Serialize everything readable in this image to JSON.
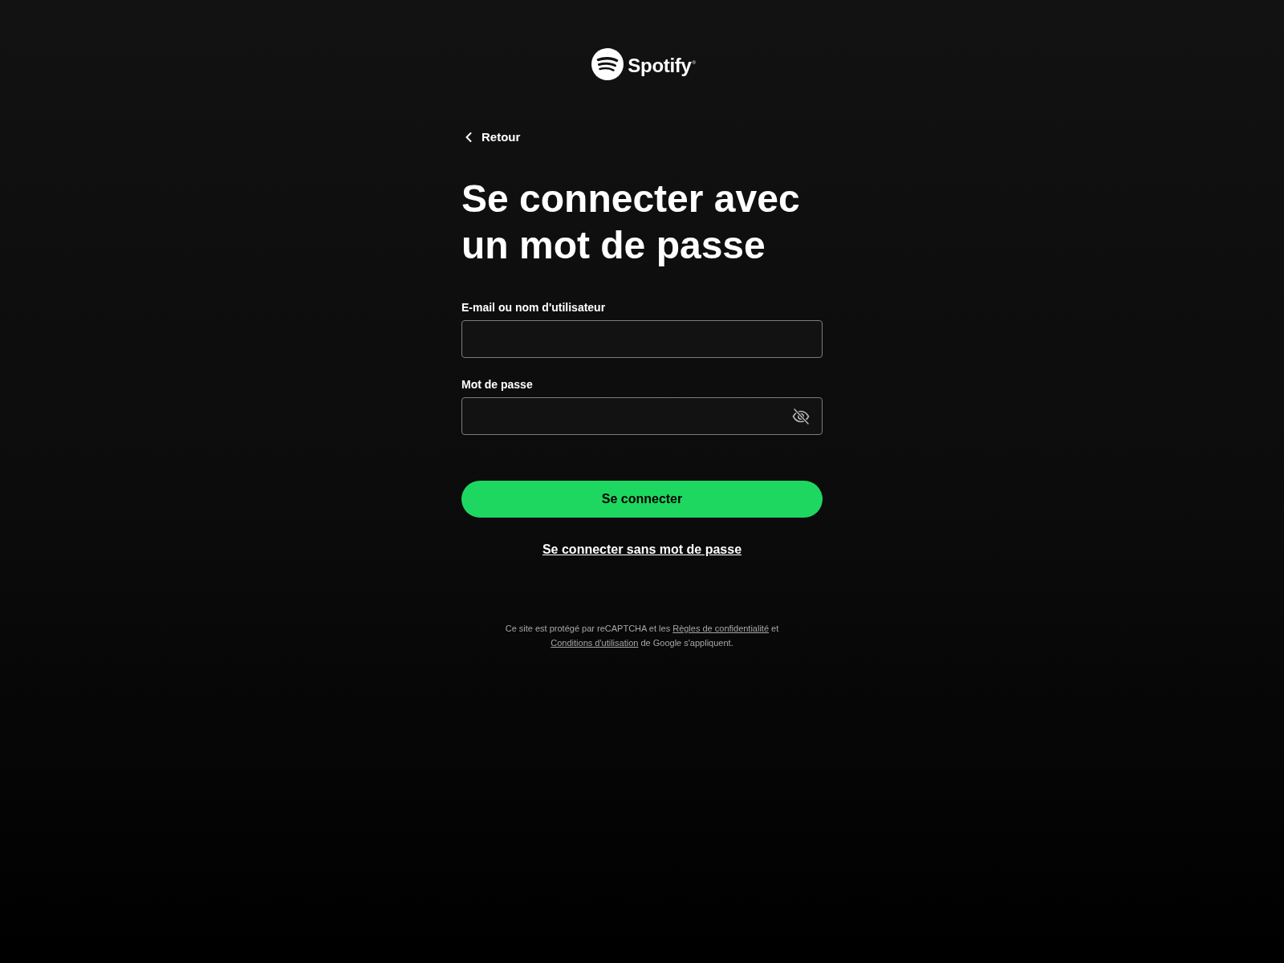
{
  "logo": {
    "wordmark": "Spotify$^{®}$"
  },
  "back_link": {
    "label": "Retour"
  },
  "heading": "Se connecter avec un mot de passe",
  "fields": [
    {
      "kind": "text",
      "label": "E-mail ou nom d'utilisateur"
    },
    {
      "kind": "password",
      "label": "Mot de passe",
      "password_visible": false
    }
  ],
  "submit_button": {
    "label": "Se connecter"
  },
  "alt_link": {
    "label": "Se connecter sans mot de passe"
  },
  "legal_notice": {
    "parts": [
      {
        "kind": "text",
        "text": "Ce site est protégé par reCAPTCHA et les "
      },
      {
        "kind": "link",
        "text": "Règles de confidentialité"
      },
      {
        "kind": "text",
        "text": " et "
      },
      {
        "kind": "link",
        "text": "Conditions d'utilisation"
      },
      {
        "kind": "text",
        "text": " de Google s'appliquent."
      }
    ]
  }
}
